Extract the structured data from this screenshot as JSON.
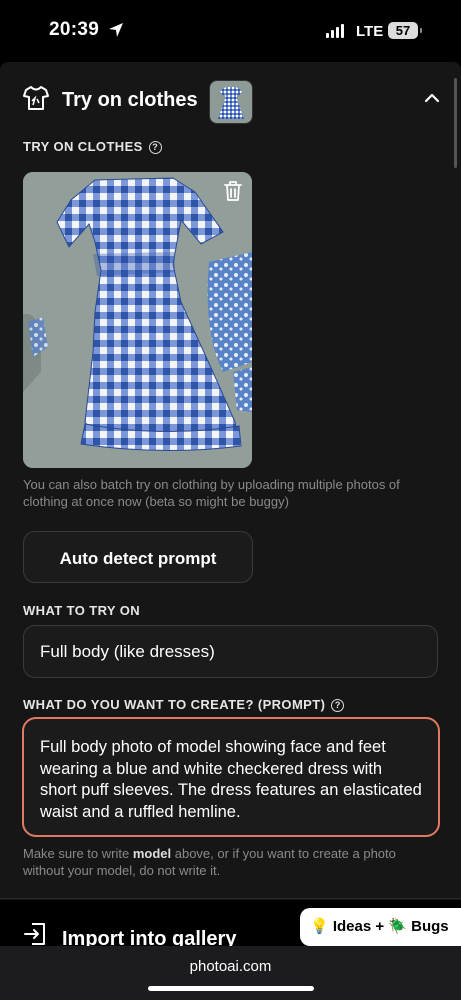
{
  "status": {
    "time": "20:39",
    "network": "LTE",
    "battery": "57"
  },
  "header": {
    "title": "Try on clothes"
  },
  "tryon": {
    "section_label": "TRY ON CLOTHES",
    "batch_hint": "You can also batch try on clothing by uploading multiple photos of clothing at once now (beta so might be buggy)",
    "auto_detect_label": "Auto detect prompt"
  },
  "what_to_try": {
    "label": "WHAT TO TRY ON",
    "selected": "Full body (like dresses)"
  },
  "prompt": {
    "label": "WHAT DO YOU WANT TO CREATE? (PROMPT)",
    "value": "Full body photo of model showing face and feet wearing a blue and white checkered dress with short puff sleeves. The dress features an elasticated waist and a ruffled hemline.",
    "hint_prefix": "Make sure to write ",
    "hint_bold": "model",
    "hint_suffix": " above, or if you want to create a photo without your model, do not write it."
  },
  "import": {
    "label": "Import into gallery"
  },
  "feedback": {
    "label": "💡 Ideas + 🪲 Bugs"
  },
  "browser": {
    "url": "photoai.com"
  },
  "colors": {
    "accent": "#e07b62",
    "panel": "#161616",
    "gingham_blue": "#2f54a8"
  },
  "icons": [
    "location-arrow-icon",
    "signal-icon",
    "battery-icon",
    "shirt-icon",
    "chevron-up-icon",
    "help-icon",
    "trash-icon",
    "import-icon"
  ]
}
